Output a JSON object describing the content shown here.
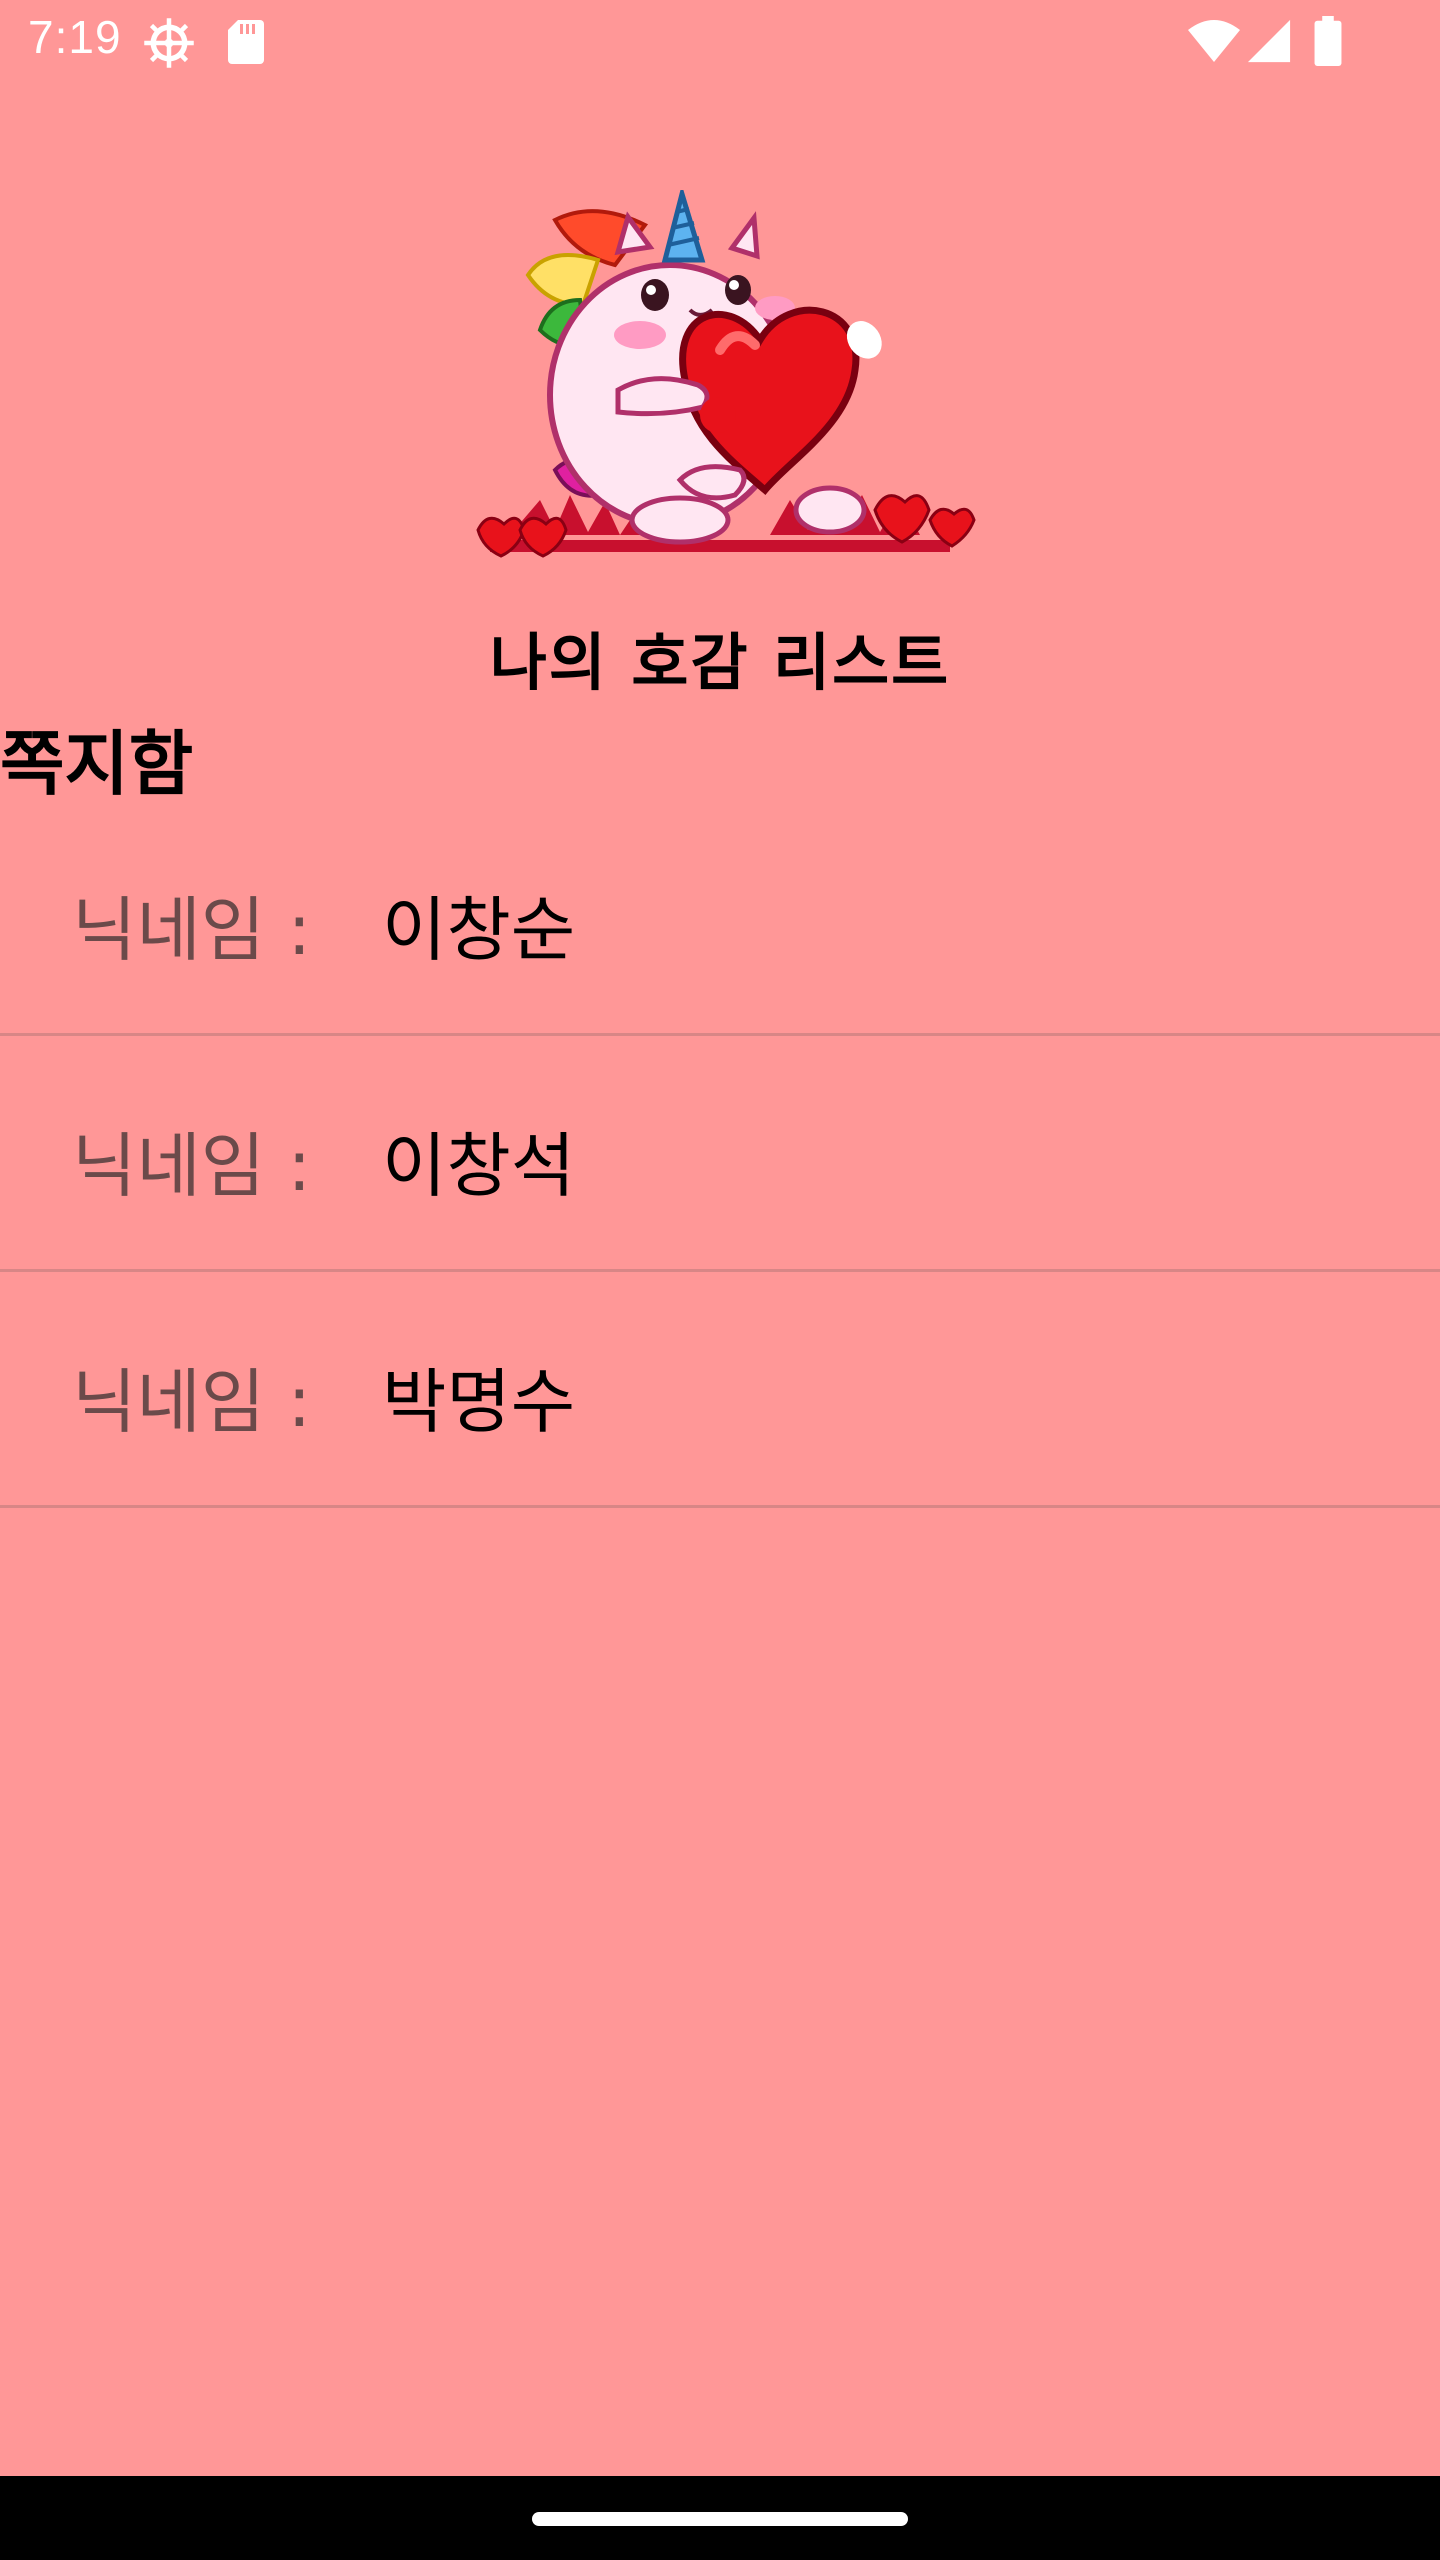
{
  "status_bar": {
    "time": "7:19",
    "icons": [
      "gear-icon",
      "sd-card-icon",
      "wifi-icon",
      "signal-icon",
      "battery-icon"
    ]
  },
  "header": {
    "illustration": "unicorn-with-heart",
    "title": "나의 호감 리스트"
  },
  "section": {
    "title": "쪽지함"
  },
  "list": {
    "items": [
      {
        "label": "닉네임 :",
        "value": "이창순"
      },
      {
        "label": "닉네임 :",
        "value": "이창석"
      },
      {
        "label": "닉네임 :",
        "value": "박명수"
      }
    ]
  },
  "colors": {
    "background": "#ff9797",
    "divider": "#d88686",
    "label": "#6b4a4a",
    "heart": "#e8121b"
  }
}
